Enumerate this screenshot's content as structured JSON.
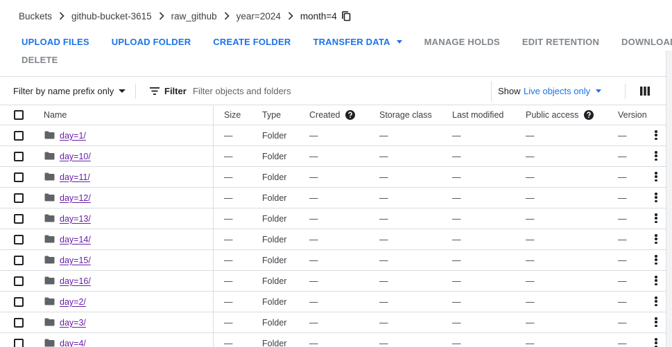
{
  "breadcrumb": {
    "items": [
      "Buckets",
      "github-bucket-3615",
      "raw_github",
      "year=2024"
    ],
    "current": "month=4"
  },
  "toolbar": {
    "upload_files": "UPLOAD FILES",
    "upload_folder": "UPLOAD FOLDER",
    "create_folder": "CREATE FOLDER",
    "transfer_data": "TRANSFER DATA",
    "manage_holds": "MANAGE HOLDS",
    "edit_retention": "EDIT RETENTION",
    "download": "DOWNLOAD",
    "delete": "DELETE"
  },
  "filter": {
    "prefix_option": "Filter by name prefix only",
    "filter_label": "Filter",
    "placeholder": "Filter objects and folders",
    "show_label": "Show",
    "show_value": "Live objects only"
  },
  "table": {
    "headers": {
      "name": "Name",
      "size": "Size",
      "type": "Type",
      "created": "Created",
      "storage_class": "Storage class",
      "last_modified": "Last modified",
      "public_access": "Public access",
      "version": "Version"
    },
    "rows": [
      {
        "name": "day=1/",
        "size": "—",
        "type": "Folder",
        "created": "—",
        "storage_class": "—",
        "last_modified": "—",
        "public_access": "—",
        "version": "—"
      },
      {
        "name": "day=10/",
        "size": "—",
        "type": "Folder",
        "created": "—",
        "storage_class": "—",
        "last_modified": "—",
        "public_access": "—",
        "version": "—"
      },
      {
        "name": "day=11/",
        "size": "—",
        "type": "Folder",
        "created": "—",
        "storage_class": "—",
        "last_modified": "—",
        "public_access": "—",
        "version": "—"
      },
      {
        "name": "day=12/",
        "size": "—",
        "type": "Folder",
        "created": "—",
        "storage_class": "—",
        "last_modified": "—",
        "public_access": "—",
        "version": "—"
      },
      {
        "name": "day=13/",
        "size": "—",
        "type": "Folder",
        "created": "—",
        "storage_class": "—",
        "last_modified": "—",
        "public_access": "—",
        "version": "—"
      },
      {
        "name": "day=14/",
        "size": "—",
        "type": "Folder",
        "created": "—",
        "storage_class": "—",
        "last_modified": "—",
        "public_access": "—",
        "version": "—"
      },
      {
        "name": "day=15/",
        "size": "—",
        "type": "Folder",
        "created": "—",
        "storage_class": "—",
        "last_modified": "—",
        "public_access": "—",
        "version": "—"
      },
      {
        "name": "day=16/",
        "size": "—",
        "type": "Folder",
        "created": "—",
        "storage_class": "—",
        "last_modified": "—",
        "public_access": "—",
        "version": "—"
      },
      {
        "name": "day=2/",
        "size": "—",
        "type": "Folder",
        "created": "—",
        "storage_class": "—",
        "last_modified": "—",
        "public_access": "—",
        "version": "—"
      },
      {
        "name": "day=3/",
        "size": "—",
        "type": "Folder",
        "created": "—",
        "storage_class": "—",
        "last_modified": "—",
        "public_access": "—",
        "version": "—"
      },
      {
        "name": "day=4/",
        "size": "—",
        "type": "Folder",
        "created": "—",
        "storage_class": "—",
        "last_modified": "—",
        "public_access": "—",
        "version": "—"
      }
    ]
  },
  "icons": {
    "copy": "copy-icon",
    "filter": "filter-list-icon",
    "columns": "view-column-icon",
    "help": "help-icon",
    "folder": "folder-icon",
    "more": "more-vert-icon"
  },
  "colors": {
    "accent": "#1a73e8",
    "link_visited": "#681da8",
    "disabled": "#80868b",
    "border": "#dadce0"
  }
}
